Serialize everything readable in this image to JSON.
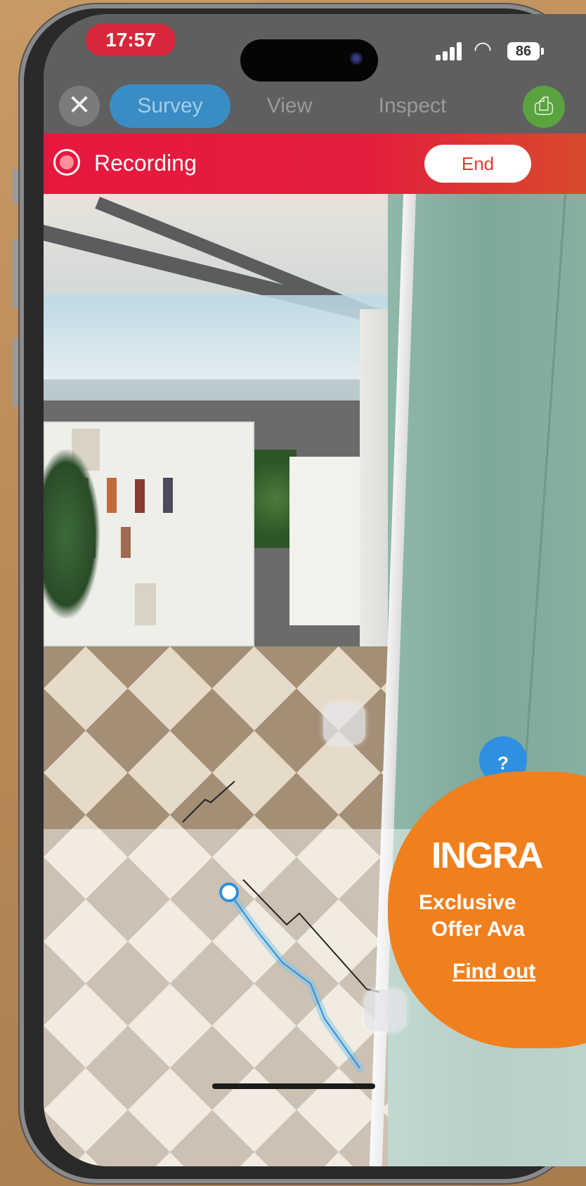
{
  "status_bar": {
    "time": "17:57",
    "battery": "86",
    "wifi_icon": "wifi-icon",
    "signal_icon": "cellular-signal-icon"
  },
  "nav": {
    "close_icon": "close-icon",
    "tabs": [
      {
        "label": "Survey",
        "active": true
      },
      {
        "label": "View",
        "active": false
      },
      {
        "label": "Inspect",
        "active": false
      }
    ],
    "clip_icon": "paperclip-icon"
  },
  "recording": {
    "label": "Recording",
    "end_label": "End"
  },
  "help": {
    "label": "?"
  },
  "ad": {
    "logo": "INGRA",
    "line1": "Exclusive",
    "line2": "Offer Ava",
    "link": "Find out"
  },
  "colors": {
    "recording_bar": "#e8173e",
    "active_tab": "#3a8cc4",
    "clip_button": "#5aa33f",
    "ad": "#f0801f"
  }
}
